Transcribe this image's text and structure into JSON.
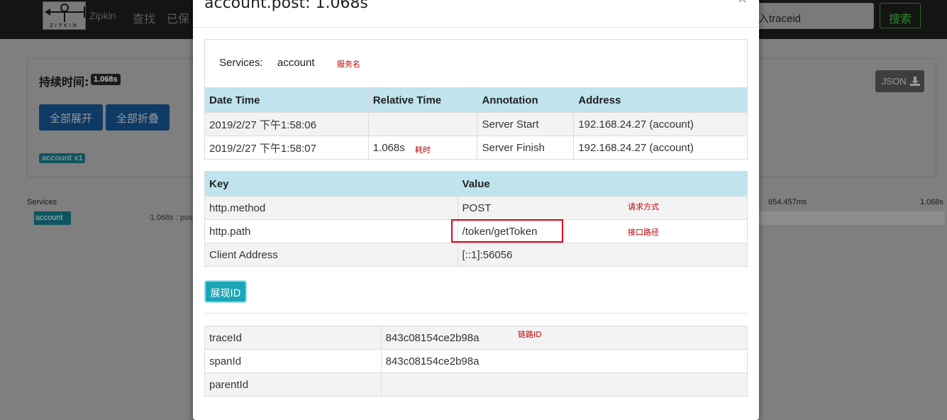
{
  "nav": {
    "brand": "Zipkin",
    "logo_text": "ZIPKIN",
    "links": [
      "查找",
      "已保"
    ],
    "search_value": "入traceid",
    "search_button": "搜索"
  },
  "summary": {
    "duration_label": "持续时间:",
    "duration_value": "1.068s",
    "expand_all": "全部展开",
    "collapse_all": "全部折叠",
    "service_badge": "account x1",
    "json_button": "JSON"
  },
  "timeline": {
    "services_label": "Services",
    "service_name": "account",
    "span_text": "·1.068s : pos",
    "ticks": [
      "854.457ms",
      "1.068s"
    ]
  },
  "modal": {
    "title": "account.post: 1.068s",
    "close": "×",
    "services_key": "Services:",
    "services_value": "account",
    "note_service": "服务名",
    "annotations": {
      "headers": [
        "Date Time",
        "Relative Time",
        "Annotation",
        "Address"
      ],
      "rows": [
        [
          "2019/2/27 下午1:58:06",
          "",
          "Server Start",
          "192.168.24.27 (account)"
        ],
        [
          "2019/2/27 下午1:58:07",
          "1.068s",
          "Server Finish",
          "192.168.24.27 (account)"
        ]
      ],
      "note_elapsed": "耗时"
    },
    "tags": {
      "headers": [
        "Key",
        "Value"
      ],
      "rows": [
        [
          "http.method",
          "POST"
        ],
        [
          "http.path",
          "/token/getToken"
        ],
        [
          "Client Address",
          "[::1]:56056"
        ]
      ],
      "note_method": "请求方式",
      "note_path": "接口路径"
    },
    "show_id_button": "展现ID",
    "ids": {
      "rows": [
        [
          "traceId",
          "843c08154ce2b98a"
        ],
        [
          "spanId",
          "843c08154ce2b98a"
        ],
        [
          "parentId",
          ""
        ]
      ],
      "note_trace": "链路ID"
    }
  }
}
